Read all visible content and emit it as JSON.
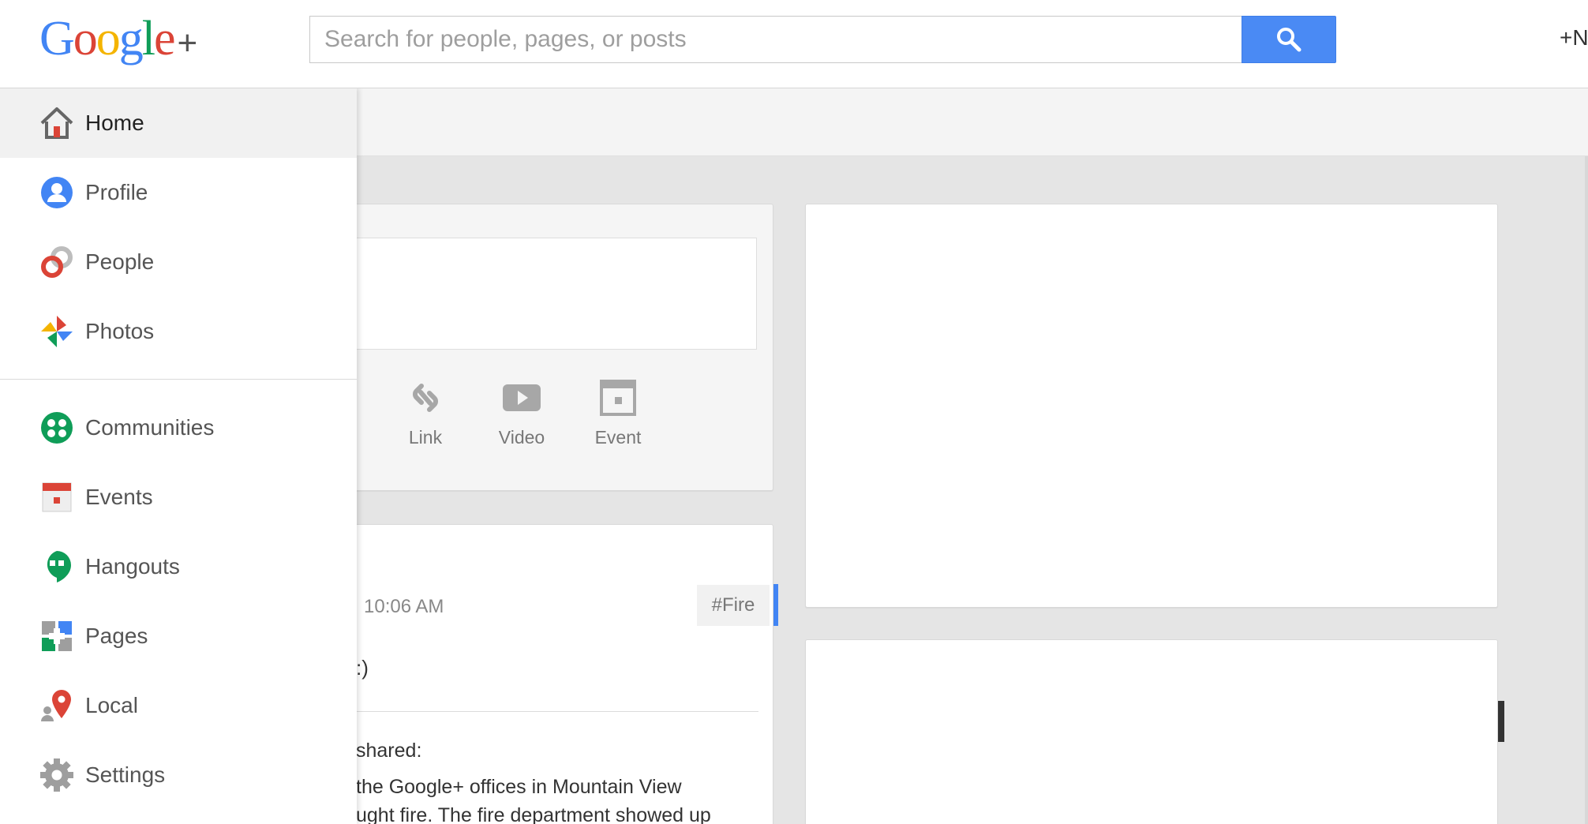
{
  "header": {
    "logo_letters": [
      "G",
      "o",
      "o",
      "g",
      "l",
      "e"
    ],
    "logo_plus": "+",
    "search_placeholder": "Search for people, pages, or posts",
    "plus_name": "+N"
  },
  "sidebar": {
    "items": [
      {
        "label": "Home",
        "icon": "home-icon"
      },
      {
        "label": "Profile",
        "icon": "profile-icon"
      },
      {
        "label": "People",
        "icon": "people-icon"
      },
      {
        "label": "Photos",
        "icon": "photos-icon"
      },
      {
        "label": "Communities",
        "icon": "communities-icon"
      },
      {
        "label": "Events",
        "icon": "events-icon"
      },
      {
        "label": "Hangouts",
        "icon": "hangouts-icon"
      },
      {
        "label": "Pages",
        "icon": "pages-icon"
      },
      {
        "label": "Local",
        "icon": "local-icon"
      },
      {
        "label": "Settings",
        "icon": "settings-icon"
      }
    ],
    "active": "Home"
  },
  "share": {
    "actions": [
      {
        "label": "Link",
        "icon": "link-icon"
      },
      {
        "label": "Video",
        "icon": "video-icon"
      },
      {
        "label": "Event",
        "icon": "event-icon"
      }
    ]
  },
  "post": {
    "time": "10:06 AM",
    "hashtag": "#Fire",
    "smiley": ":)",
    "shared_label": "shared:",
    "body_line1": "the Google+ offices in Mountain View",
    "body_line2": "ught fire. The fire department showed up"
  },
  "colors": {
    "accent_blue": "#4a8af4",
    "google_red": "#db4437",
    "google_yellow": "#f4b400",
    "google_green": "#0f9d58",
    "google_blue": "#4285f4"
  }
}
